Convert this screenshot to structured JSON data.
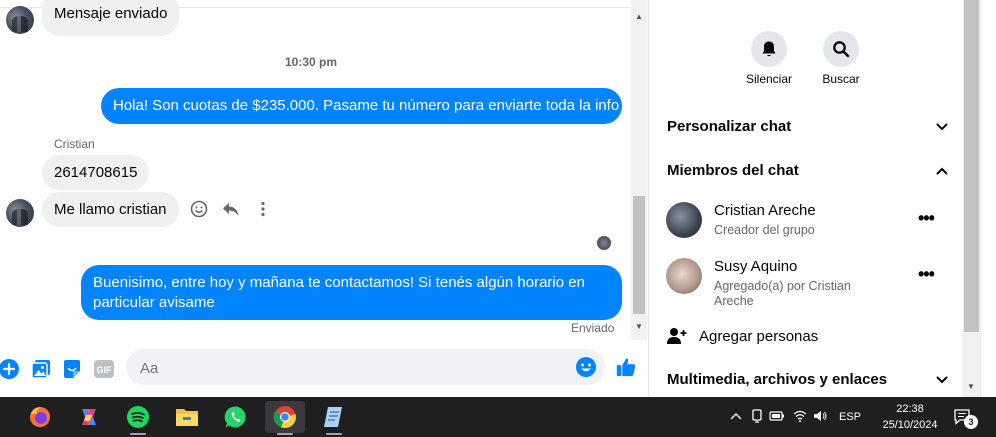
{
  "chat": {
    "messages": {
      "prev_sent": "Mensaje enviado",
      "timestamp": "10:30 pm",
      "outgoing_1": "Hola! Son cuotas de $235.000. Pasame tu número para enviarte toda la info",
      "sender_name": "Cristian",
      "incoming_1": "2614708615",
      "incoming_2": "Me llamo cristian",
      "outgoing_2_line1": "Buenisimo, entre hoy y mañana te contactamos! Si tenés algún horario en",
      "outgoing_2_line2": "particular avisame",
      "status": "Enviado"
    },
    "composer": {
      "placeholder": "Aa"
    },
    "accent_color": "#0084ff"
  },
  "info_panel": {
    "quick_actions": [
      {
        "label": "Silenciar",
        "icon": "bell-icon"
      },
      {
        "label": "Buscar",
        "icon": "search-icon"
      }
    ],
    "sections": {
      "customize": "Personalizar chat",
      "members": "Miembros del chat",
      "media": "Multimedia, archivos y enlaces"
    },
    "members": [
      {
        "name": "Cristian Areche",
        "role": "Creador del grupo"
      },
      {
        "name": "Susy Aquino",
        "role": "Agregado(a) por Cristian Areche"
      }
    ],
    "add_people": "Agregar personas"
  },
  "taskbar": {
    "apps": [
      "firefox-icon",
      "copilot-icon",
      "spotify-icon",
      "file-explorer-icon",
      "whatsapp-icon",
      "chrome-icon",
      "notepad-icon"
    ],
    "language": "ESP",
    "time": "22:38",
    "date": "25/10/2024",
    "notification_count": "3"
  }
}
